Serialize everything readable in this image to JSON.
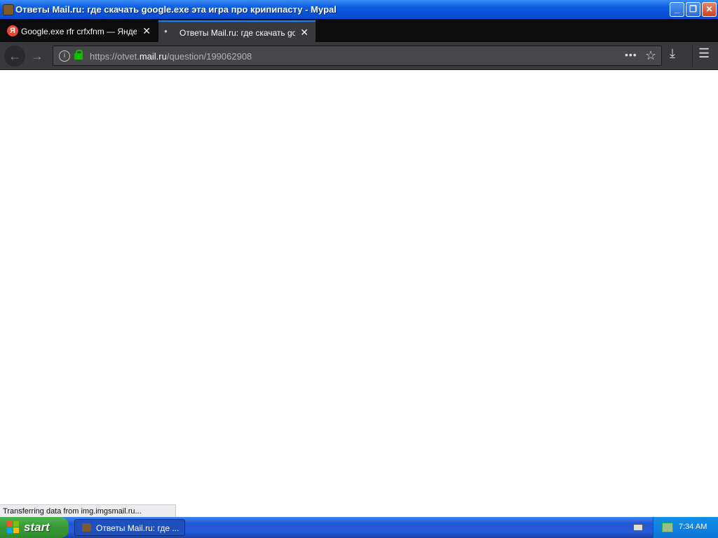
{
  "window": {
    "title": "Ответы Mail.ru: где скачать google.exe эта игра про крипипасту - Mypal",
    "minimize_glyph": "_",
    "restore_glyph": "❐",
    "close_glyph": "✕"
  },
  "tabs": [
    {
      "label": "Google.exe rfr crfxfnm — Яндекс",
      "favicon": "Я",
      "close_glyph": "✕",
      "active": false
    },
    {
      "label": "Ответы Mail.ru: где скачать google.exe",
      "close_glyph": "✕",
      "active": true
    }
  ],
  "nav": {
    "back_glyph": "←",
    "forward_glyph": "→",
    "url_prefix": "https://otvet.",
    "url_host": "mail.ru",
    "url_path": "/question/199062908",
    "info_glyph": "i",
    "page_actions_glyph": "•••",
    "bookmark_glyph": "☆",
    "download_glyph": "⤓",
    "menu_glyph": "☰"
  },
  "status_text": "Transferring data from img.imgsmail.ru...",
  "taskbar": {
    "start_label": "start",
    "task_label": "Ответы Mail.ru: где ...",
    "clock": "7:34 AM"
  },
  "colors": {
    "titlebar": "#0a5be0",
    "tab_accent": "#0a84ff",
    "lock": "#12bc00",
    "start_green": "#3a9c38"
  }
}
